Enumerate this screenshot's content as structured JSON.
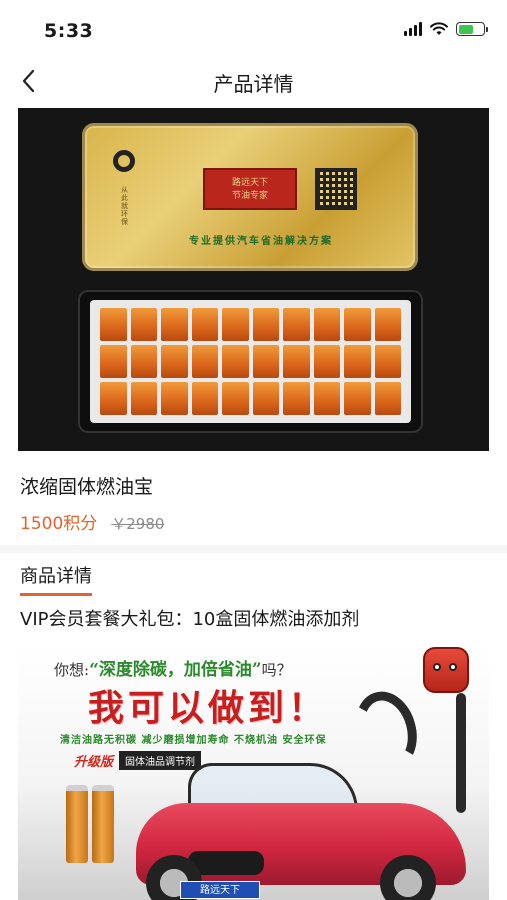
{
  "status_bar": {
    "time": "5:33",
    "battery_level": 0.6,
    "icons": [
      "signal-icon",
      "wifi-icon",
      "battery-icon"
    ]
  },
  "nav": {
    "title": "产品详情",
    "back_icon": "chevron-left-icon"
  },
  "product": {
    "name": "浓缩固体燃油宝",
    "price_points": "1500积分",
    "price_original": "￥2980"
  },
  "box_image": {
    "side_text": "从此就环保",
    "seal_text_line1": "路远天下",
    "seal_text_line2": "节油专家",
    "slogan": "专业提供汽车省油解决方案"
  },
  "details": {
    "section_title": "商品详情",
    "description": "VIP会员套餐大礼包：10盒固体燃油添加剂"
  },
  "detail_image": {
    "q_prefix": "你想:",
    "q_quote": "“深度除碳，加倍省油”",
    "q_suffix": "吗？",
    "big_slogan": "我可以做到！",
    "features": "清洁油路无积碳    减少磨损增加寿命    不烧机油    安全环保",
    "upgrade_tag": "升级版",
    "upgrade_sub": "固体油品调节剂",
    "plate": "路远天下"
  },
  "colors": {
    "accent": "#e4632d",
    "text": "#1a1a1a",
    "muted": "#8a8a8a"
  }
}
